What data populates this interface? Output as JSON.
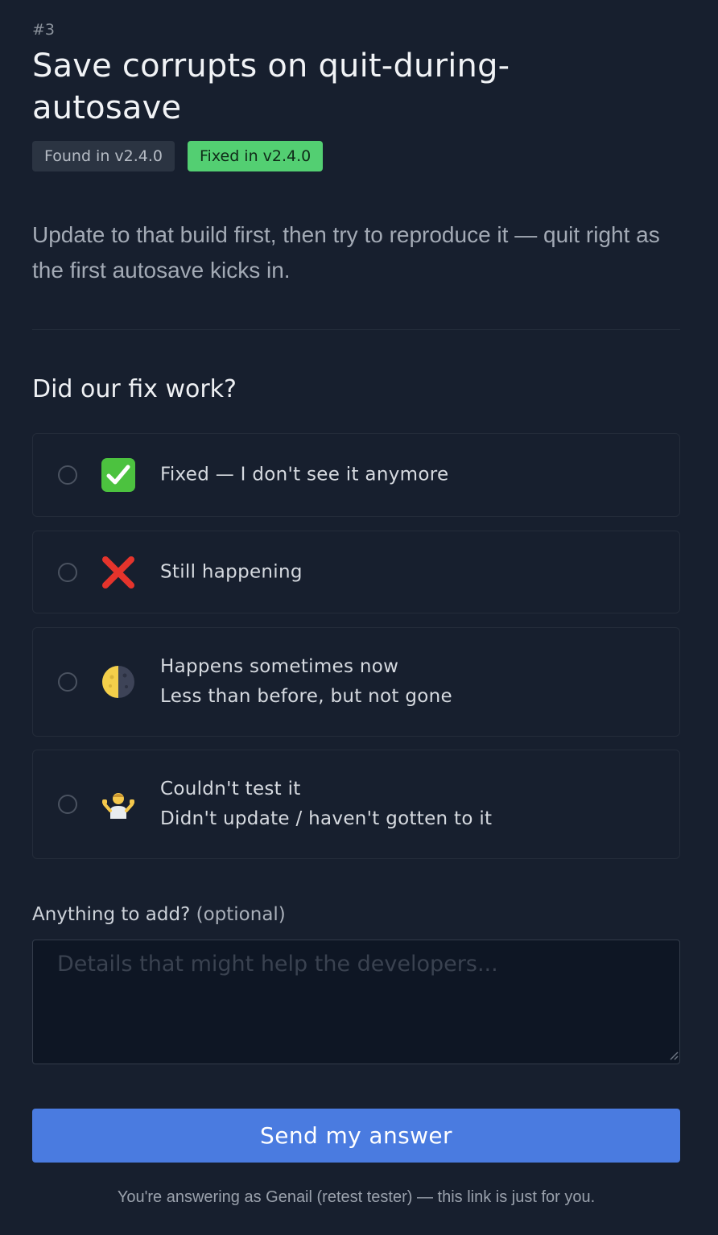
{
  "issue": {
    "number": "#3",
    "title": "Save corrupts on quit-during-autosave",
    "badges": {
      "found": "Found in v2.4.0",
      "fixed": "Fixed in v2.4.0"
    },
    "description": "Update to that build first, then try to reproduce it — quit right as the first autosave kicks in."
  },
  "question": "Did our fix work?",
  "options": [
    {
      "icon": "check-mark-emoji",
      "line1": "Fixed — I don't see it anymore",
      "line2": ""
    },
    {
      "icon": "cross-mark-emoji",
      "line1": "Still happening",
      "line2": ""
    },
    {
      "icon": "half-moon-emoji",
      "line1": "Happens sometimes now",
      "line2": "Less than before, but not gone"
    },
    {
      "icon": "shrug-emoji",
      "line1": "Couldn't test it",
      "line2": "Didn't update / haven't gotten to it"
    }
  ],
  "comment": {
    "label": "Anything to add?",
    "optional": "(optional)",
    "placeholder": "Details that might help the developers..."
  },
  "submit_label": "Send my answer",
  "footer": "You're answering as Genail (retest tester) — this link is just for you.",
  "colors": {
    "background": "#171f2e",
    "accent": "#4a7be0",
    "fixed_badge": "#53cf72"
  }
}
